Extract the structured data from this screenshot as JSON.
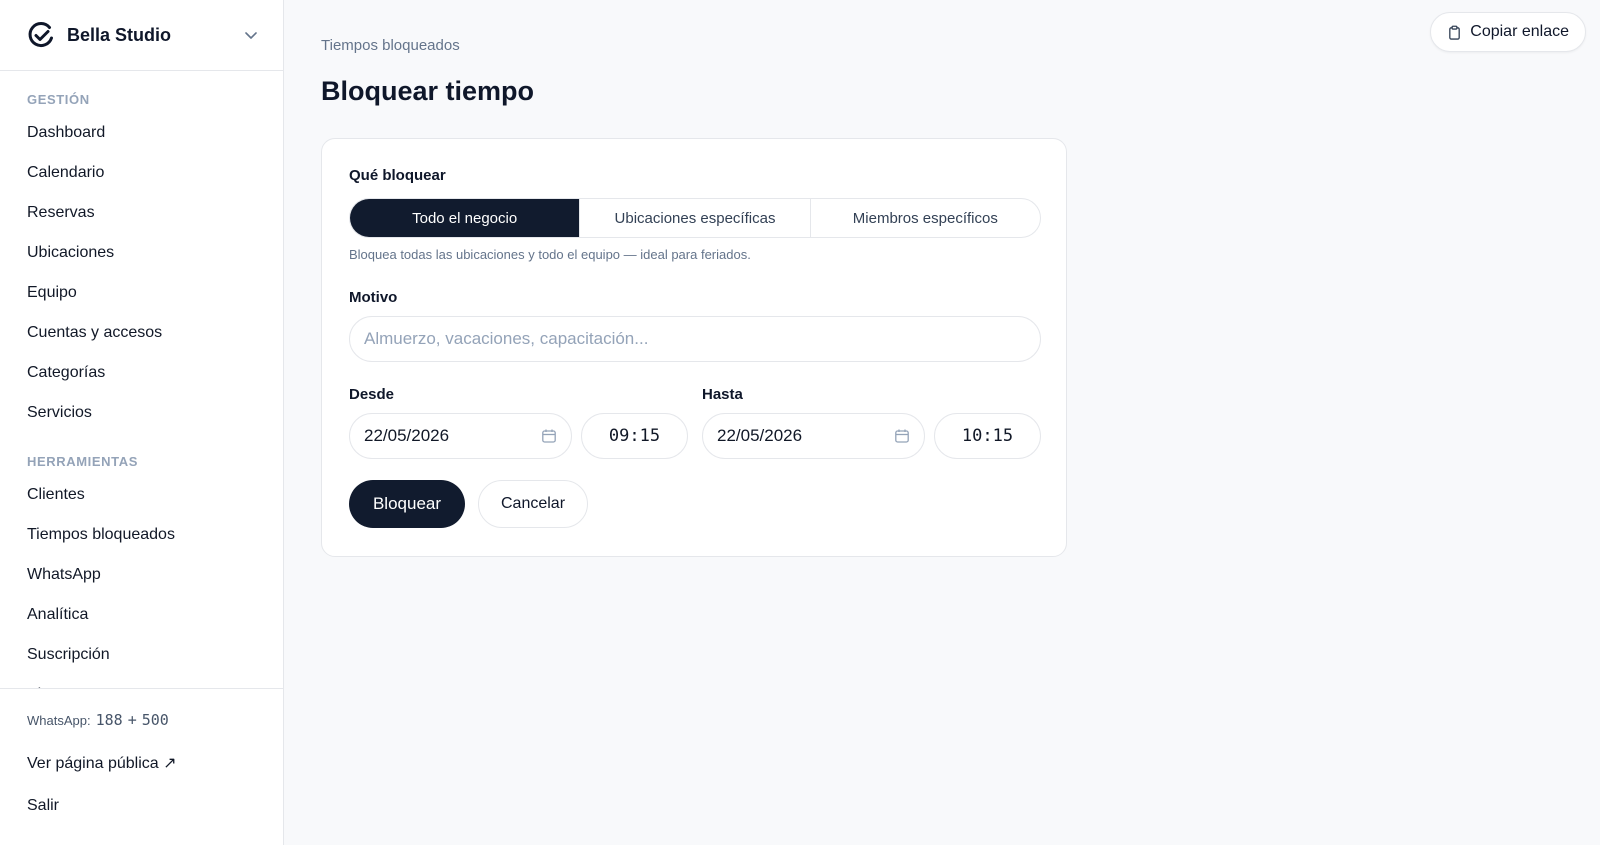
{
  "brand": {
    "name": "Bella Studio"
  },
  "sidebar": {
    "sections": [
      {
        "title": "GESTIÓN",
        "items": [
          "Dashboard",
          "Calendario",
          "Reservas",
          "Ubicaciones",
          "Equipo",
          "Cuentas y accesos",
          "Categorías",
          "Servicios"
        ]
      },
      {
        "title": "HERRAMIENTAS",
        "items": [
          "Clientes",
          "Tiempos bloqueados",
          "WhatsApp",
          "Analítica",
          "Suscripción",
          "Ajustes"
        ]
      }
    ],
    "footer": {
      "whatsapp_label": "WhatsApp:",
      "whatsapp_used": "188",
      "whatsapp_plus": "+",
      "whatsapp_extra": "500",
      "public_page": "Ver página pública ↗",
      "logout": "Salir"
    }
  },
  "header": {
    "copy_link": "Copiar enlace"
  },
  "page": {
    "breadcrumb": "Tiempos bloqueados",
    "title": "Bloquear tiempo"
  },
  "form": {
    "what_label": "Qué bloquear",
    "scope_options": [
      "Todo el negocio",
      "Ubicaciones específicas",
      "Miembros específicos"
    ],
    "scope_selected": "Todo el negocio",
    "scope_hint": "Bloquea todas las ubicaciones y todo el equipo — ideal para feriados.",
    "reason_label": "Motivo",
    "reason_placeholder": "Almuerzo, vacaciones, capacitación...",
    "from_label": "Desde",
    "from_date": "22/05/2026",
    "from_time": "09:15",
    "to_label": "Hasta",
    "to_date": "22/05/2026",
    "to_time": "10:15",
    "submit": "Bloquear",
    "cancel": "Cancelar"
  }
}
